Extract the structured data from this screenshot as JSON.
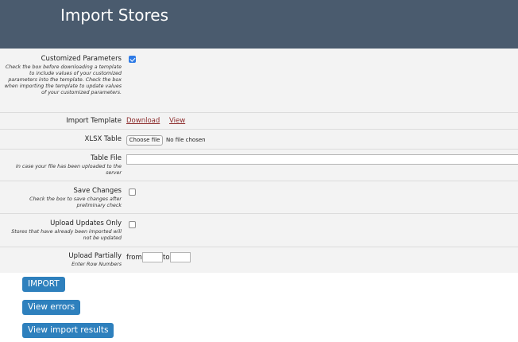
{
  "header": {
    "title": "Import Stores"
  },
  "form": {
    "customized_parameters": {
      "label": "Customized Parameters",
      "hint": "Check the box before downloading a template to include values of your customized parameters into the template. Check the box when importing the template to update values of your customized parameters.",
      "checked": true
    },
    "import_template": {
      "label": "Import Template",
      "download_label": "Download",
      "view_label": "View"
    },
    "xlsx_table": {
      "label": "XLSX Table",
      "choose_label": "Choose file",
      "status": "No file chosen"
    },
    "table_file": {
      "label": "Table File",
      "hint": "In case your file has been uploaded to the server",
      "value": ""
    },
    "save_changes": {
      "label": "Save Changes",
      "hint": "Check the box to save changes after preliminary check",
      "checked": false
    },
    "upload_updates_only": {
      "label": "Upload Updates Only",
      "hint": "Stores that have already been imported will not be updated",
      "checked": false
    },
    "upload_partially": {
      "label": "Upload Partially",
      "hint": "Enter Row Numbers",
      "from_label": "from",
      "to_label": "to",
      "from_value": "",
      "to_value": ""
    }
  },
  "actions": {
    "import_label": "IMPORT",
    "view_errors_label": "View errors",
    "view_results_label": "View import results"
  },
  "colors": {
    "header_bg": "#4a5b6e",
    "button_bg": "#2e80bd",
    "link": "#8b2a2a",
    "checkbox_checked": "#2f7be6"
  }
}
